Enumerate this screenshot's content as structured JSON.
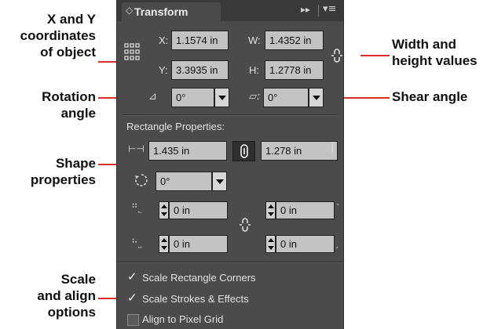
{
  "callouts": {
    "xy": "X and Y\ncoordinates\nof object",
    "rotation": "Rotation\nangle",
    "shape": "Shape\nproperties",
    "scale": "Scale\nand align\noptions",
    "wh": "Width and\nheight values",
    "shear": "Shear angle"
  },
  "panel": {
    "title": "Transform",
    "x_label": "X:",
    "x_value": "1.1574 in",
    "y_label": "Y:",
    "y_value": "3.3935 in",
    "w_label": "W:",
    "w_value": "1.4352 in",
    "h_label": "H:",
    "h_value": "1.2778 in",
    "rotation_value": "0°",
    "shear_value": "0°",
    "rect_props_title": "Rectangle Properties:",
    "rect_width": "1.435 in",
    "rect_height": "1.278 in",
    "corner_rotation": "0°",
    "corner_tl": "0 in",
    "corner_tr": "0 in",
    "corner_bl": "0 in",
    "corner_br": "0 in",
    "opt_scale_corners": "Scale Rectangle Corners",
    "opt_scale_strokes": "Scale Strokes & Effects",
    "opt_align_pixel": "Align to Pixel Grid",
    "checked_scale_corners": true,
    "checked_scale_strokes": true,
    "checked_align_pixel": false
  },
  "icons": [
    "reference-point-icon",
    "link-icon",
    "rotate-icon",
    "shear-icon",
    "width-icon",
    "height-icon",
    "corner-rotate-icon",
    "menu-icon",
    "expand-icon"
  ],
  "colors": {
    "callout_line": "#d6322a",
    "panel_bg": "#4b4b4b",
    "field_bg": "#c3c3c3"
  }
}
